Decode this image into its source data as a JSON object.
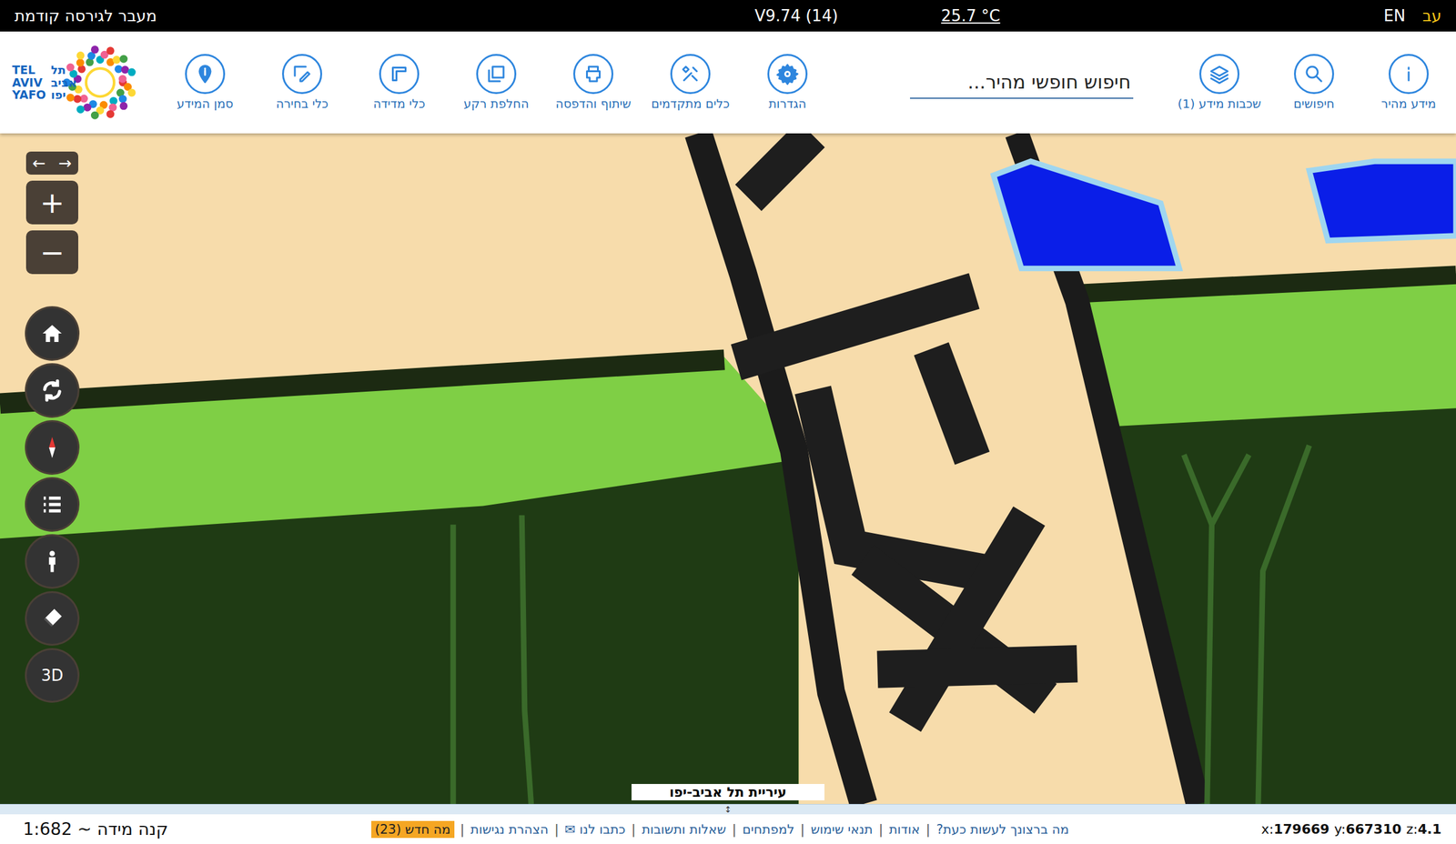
{
  "top_bar": {
    "previous_version": "מעבר לגירסה קודמת",
    "version": "V9.74 (14)",
    "temperature": "25.7 °C",
    "languages": [
      {
        "label": "EN",
        "selected": false
      },
      {
        "label": "עב",
        "selected": true
      }
    ]
  },
  "logo": {
    "lines": [
      {
        "en": "TEL",
        "he": "תל"
      },
      {
        "en": "AVIV",
        "he": "אביב"
      },
      {
        "en": "YAFO",
        "he": "יפו"
      }
    ]
  },
  "toolbar": {
    "left_tools": [
      "סמן המידע",
      "כלי בחירה",
      "כלי מדידה",
      "החלפת רקע",
      "שיתוף והדפסה",
      "כלים מתקדמים",
      "הגדרות"
    ],
    "search": {
      "placeholder": "חיפוש חופשי מהיר..."
    },
    "right_tools": [
      "שכבות מידע (1)",
      "חיפושים",
      "מידע מהיר"
    ]
  },
  "map_controls": {
    "back": "←",
    "forward": "→",
    "zoom_in": "+",
    "zoom_out": "−",
    "three_d": "3D"
  },
  "map_label": "עיריית תל אביב-יפו",
  "status_bar": {
    "handle": "↕",
    "scale": "קנה מידה ~ 1:682",
    "separator": "|",
    "links": [
      "מה ברצונך לעשות כעת?",
      "אודות",
      "תנאי שימוש",
      "למפתחים",
      "שאלות ותשובות",
      "כתבו לנו ✉",
      "הצהרת נגישות"
    ],
    "badge": "מה חדש (23)",
    "coordinates": [
      {
        "label": "x:",
        "value": "179669"
      },
      {
        "label": "y:",
        "value": "667310"
      },
      {
        "label": "z:",
        "value": "4.1"
      }
    ]
  }
}
